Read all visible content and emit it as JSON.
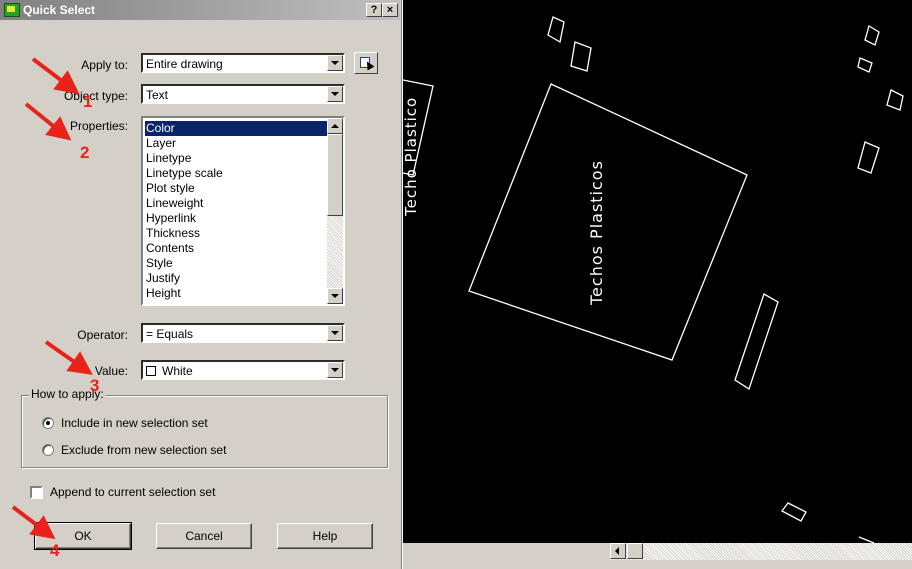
{
  "dialog": {
    "title": "Quick Select",
    "help_button": "?",
    "close_button": "×",
    "apply_to": {
      "label": "Apply to:",
      "value": "Entire drawing"
    },
    "object_type": {
      "label": "Object type:",
      "value": "Text"
    },
    "properties": {
      "label": "Properties:",
      "items": [
        "Color",
        "Layer",
        "Linetype",
        "Linetype scale",
        "Plot style",
        "Lineweight",
        "Hyperlink",
        "Thickness",
        "Contents",
        "Style",
        "Justify",
        "Height"
      ],
      "selected": "Color"
    },
    "operator": {
      "label": "Operator:",
      "value": "= Equals"
    },
    "value": {
      "label": "Value:",
      "value": "White",
      "swatch_color": "#ffffff"
    },
    "how_to_apply": {
      "title": "How to apply:",
      "include": "Include in new selection set",
      "exclude": "Exclude from new selection set",
      "selected": "include"
    },
    "append": {
      "label": "Append to current selection set",
      "checked": false
    },
    "buttons": {
      "ok": "OK",
      "cancel": "Cancel",
      "help": "Help"
    }
  },
  "annotations": {
    "color": "#e8231a",
    "numbers": [
      "1",
      "2",
      "3",
      "4"
    ]
  },
  "drawing": {
    "background": "#000000",
    "line_color": "#ffffff",
    "text_main": "Techos Plasticos",
    "text_side": "Techo Plastico"
  }
}
